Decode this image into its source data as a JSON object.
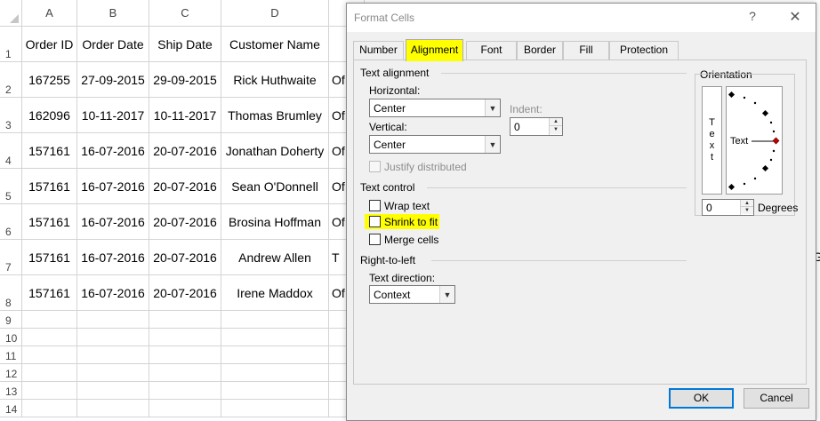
{
  "sheet": {
    "columns": [
      "A",
      "B",
      "C",
      "D"
    ],
    "rows": [
      "1",
      "2",
      "3",
      "4",
      "5",
      "6",
      "7",
      "8",
      "9",
      "10",
      "11",
      "12",
      "13",
      "14"
    ],
    "header_row": [
      "Order ID",
      "Order Date",
      "Ship Date",
      "Customer Name",
      ""
    ],
    "data": [
      [
        "167255",
        "27-09-2015",
        "29-09-2015",
        "Rick Huthwaite",
        "Of"
      ],
      [
        "162096",
        "10-11-2017",
        "10-11-2017",
        "Thomas Brumley",
        "Of"
      ],
      [
        "157161",
        "16-07-2016",
        "20-07-2016",
        "Jonathan Doherty",
        "Of"
      ],
      [
        "157161",
        "16-07-2016",
        "20-07-2016",
        "Sean O'Donnell",
        "Of"
      ],
      [
        "157161",
        "16-07-2016",
        "20-07-2016",
        "Brosina Hoffman",
        "Of"
      ],
      [
        "157161",
        "16-07-2016",
        "20-07-2016",
        "Andrew Allen",
        "T"
      ],
      [
        "157161",
        "16-07-2016",
        "20-07-2016",
        "Irene Maddox",
        "Of"
      ]
    ],
    "edge_text": "G"
  },
  "dialog": {
    "title": "Format Cells",
    "help_glyph": "?",
    "close_glyph": "✕",
    "tabs": [
      "Number",
      "Alignment",
      "Font",
      "Border",
      "Fill",
      "Protection"
    ],
    "active_tab": "Alignment",
    "highlight_color": "#ffff00",
    "text_alignment": {
      "section_label": "Text alignment",
      "horizontal_label": "Horizontal:",
      "horizontal_value": "Center",
      "vertical_label": "Vertical:",
      "vertical_value": "Center",
      "indent_label": "Indent:",
      "indent_value": "0",
      "justify_distributed_label": "Justify distributed"
    },
    "text_control": {
      "section_label": "Text control",
      "wrap_text_label": "Wrap text",
      "shrink_to_fit_label": "Shrink to fit",
      "merge_cells_label": "Merge cells"
    },
    "right_to_left": {
      "section_label": "Right-to-left",
      "text_direction_label": "Text direction:",
      "text_direction_value": "Context"
    },
    "orientation": {
      "section_label": "Orientation",
      "vertical_text": [
        "T",
        "e",
        "x",
        "t"
      ],
      "dial_text": "Text",
      "degrees_value": "0",
      "degrees_label": "Degrees",
      "marker_color": "#c00000"
    },
    "ok_label": "OK",
    "cancel_label": "Cancel"
  }
}
